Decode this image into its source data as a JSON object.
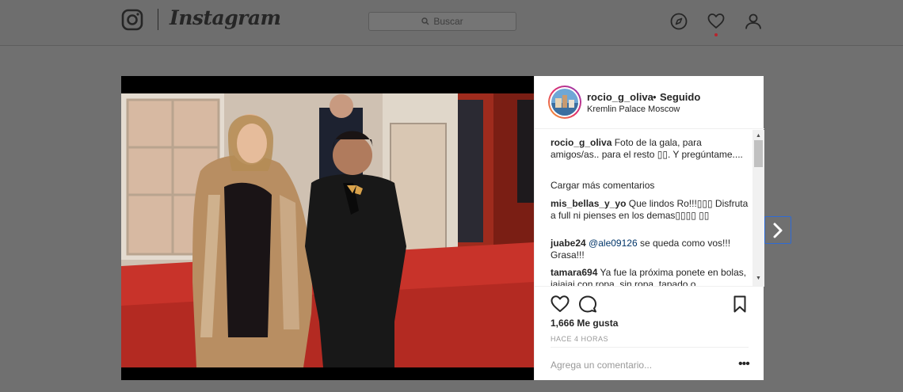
{
  "header": {
    "brand": "Instagram",
    "search_placeholder": "Buscar",
    "icons": [
      "instagram-camera-icon",
      "compass-icon",
      "heart-icon",
      "profile-icon"
    ]
  },
  "post": {
    "username": "rocio_g_oliva",
    "follow_separator": "•",
    "follow_status": "Seguido",
    "location": "Kremlin Palace Moscow",
    "caption": {
      "user": "rocio_g_oliva",
      "text": " Foto de la gala, para amigos/as.. para el resto ▯▯. Y pregúntame...."
    },
    "load_more": "Cargar más comentarios",
    "comments": [
      {
        "user": "mis_bellas_y_yo",
        "text": " Que lindos Ro!!!▯▯▯ Disfruta a full ni pienses en los demas▯▯▯▯ ▯▯"
      },
      {
        "user": "juabe24",
        "mention": "@ale09126",
        "text": " se queda como vos!!! Grasa!!!"
      },
      {
        "user": "tamara694",
        "text": " Ya fue la próxima ponete en bolas, jajajaj con ropa, sin ropa, tapado o"
      }
    ],
    "likes": "1,666 Me gusta",
    "time": "HACE 4 HORAS",
    "add_comment_placeholder": "Agrega un comentario...",
    "more_options": "•••"
  },
  "colors": {
    "overlay": "#707070",
    "text": "#262626",
    "muted": "#999999",
    "link": "#003569",
    "notification": "#b8242d",
    "focus": "#2e6bd6"
  }
}
